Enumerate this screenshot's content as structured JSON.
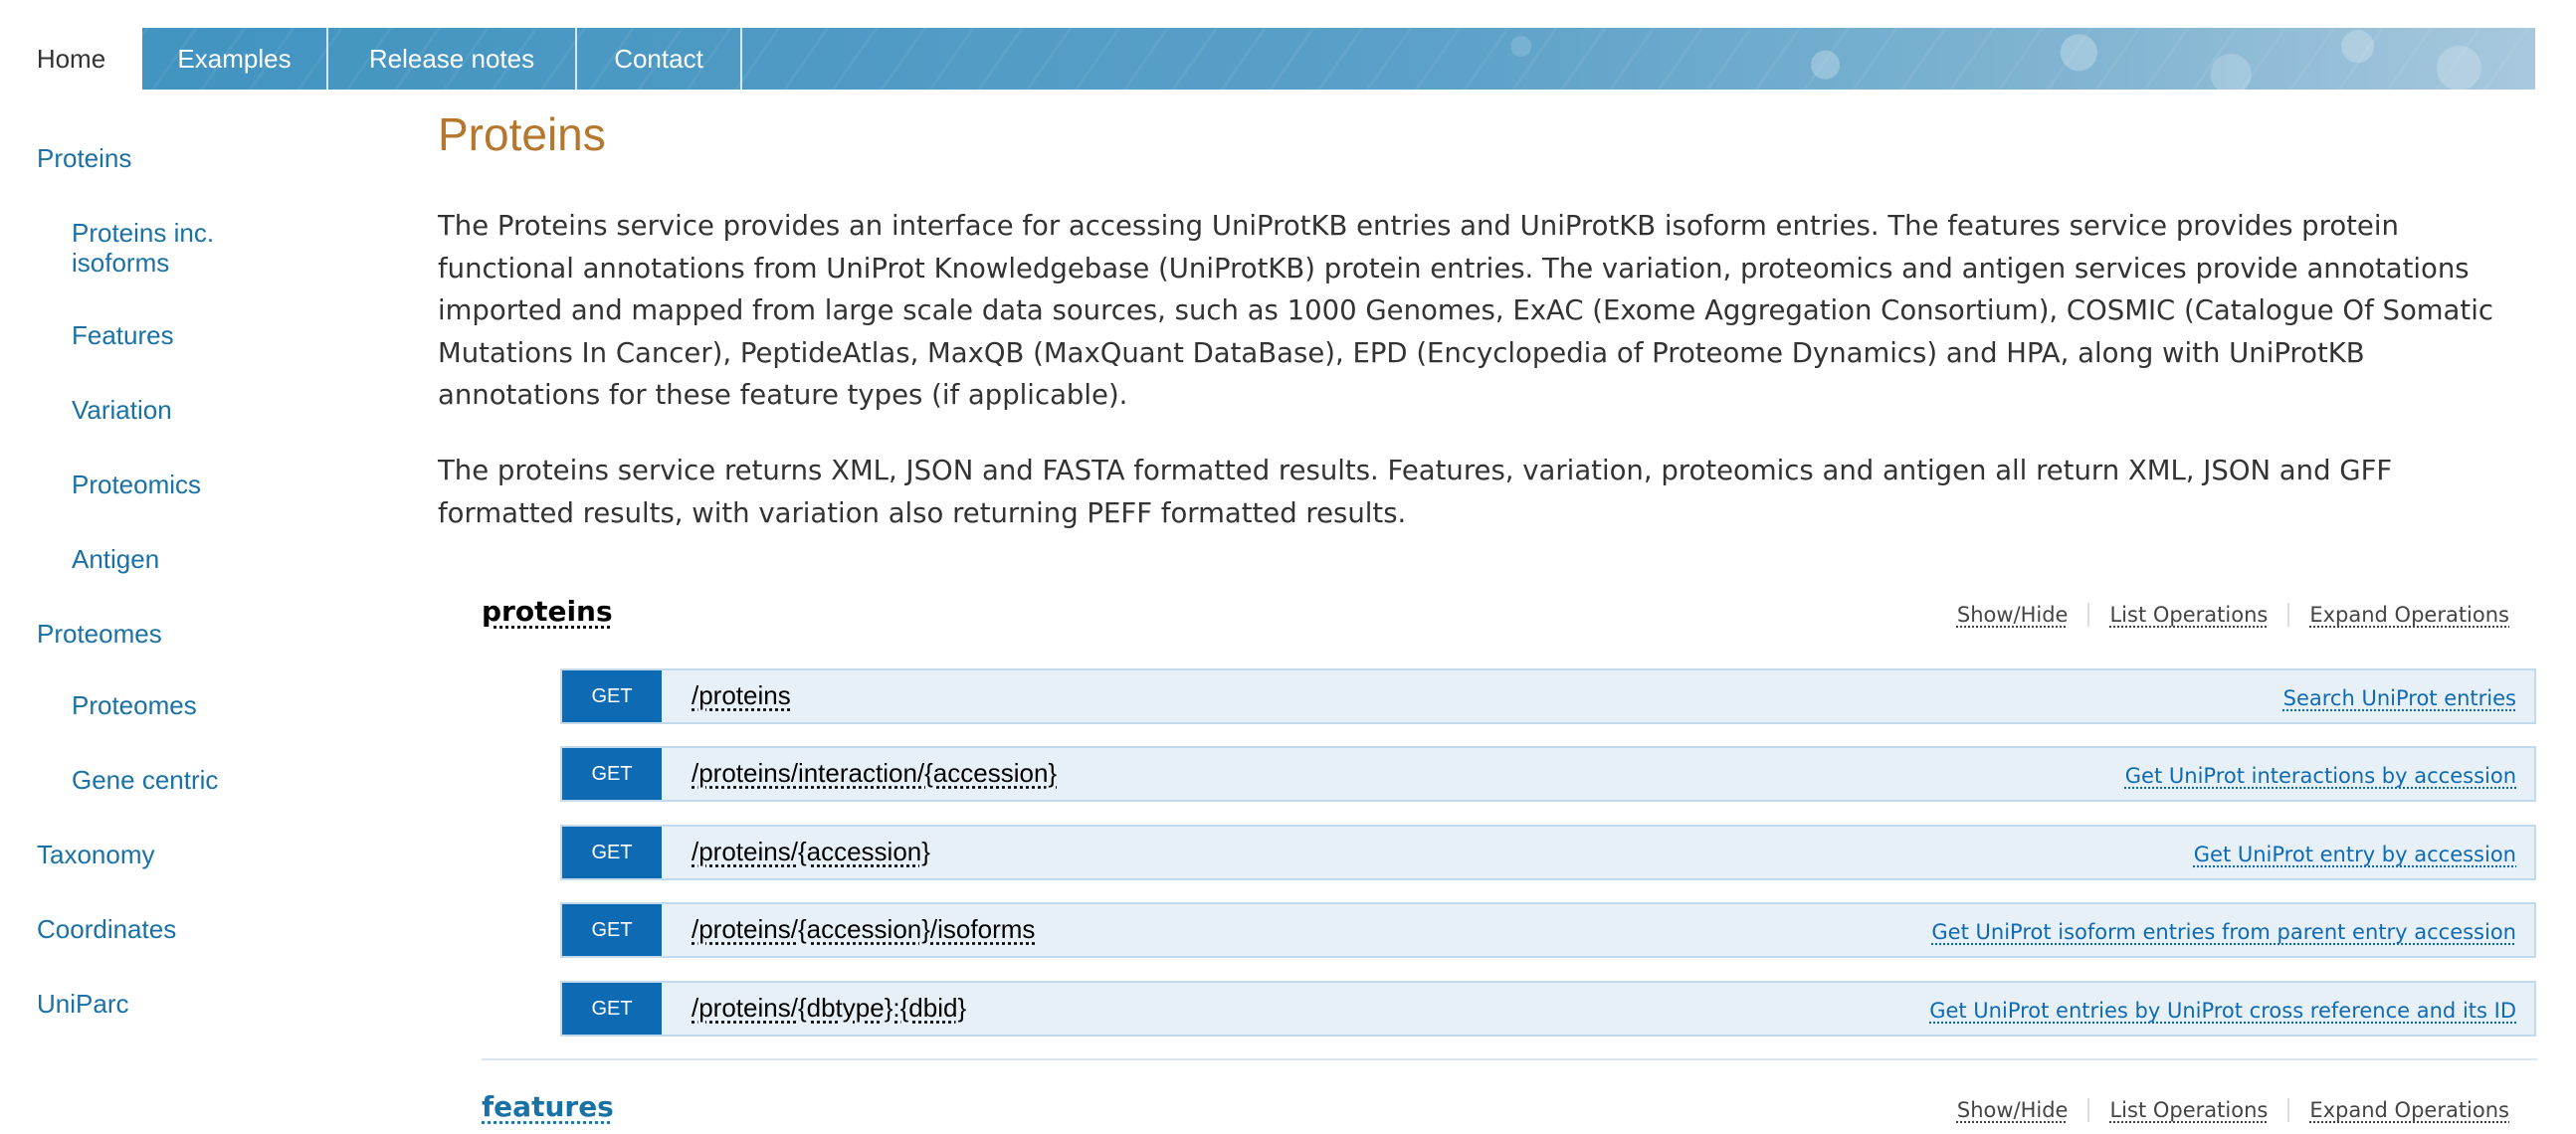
{
  "nav": {
    "tabs": [
      {
        "label": "Home"
      },
      {
        "label": "Examples"
      },
      {
        "label": "Release notes"
      },
      {
        "label": "Contact"
      }
    ]
  },
  "sidebar": {
    "items": [
      {
        "label": "Proteins"
      },
      {
        "label": "Proteins inc.\nisoforms"
      },
      {
        "label": "Features"
      },
      {
        "label": "Variation"
      },
      {
        "label": "Proteomics"
      },
      {
        "label": "Antigen"
      },
      {
        "label": "Proteomes"
      },
      {
        "label": "Proteomes"
      },
      {
        "label": "Gene centric"
      },
      {
        "label": "Taxonomy"
      },
      {
        "label": "Coordinates"
      },
      {
        "label": "UniParc"
      }
    ]
  },
  "main": {
    "title": "Proteins",
    "paragraph1": "The Proteins service provides an interface for accessing UniProtKB entries and UniProtKB isoform entries. The features service provides protein functional annotations from UniProt Knowledgebase (UniProtKB) protein entries. The variation, proteomics and antigen services provide annotations imported and mapped from large scale data sources, such as 1000 Genomes, ExAC (Exome Aggregation Consortium), COSMIC (Catalogue Of Somatic Mutations In Cancer), PeptideAtlas, MaxQB (MaxQuant DataBase), EPD (Encyclopedia of Proteome Dynamics) and HPA, along with UniProtKB annotations for these feature types (if applicable).",
    "paragraph2": "The proteins service returns XML, JSON and FASTA formatted results. Features, variation, proteomics and antigen all return XML, JSON and GFF formatted results, with variation also returning PEFF formatted results."
  },
  "swagger": {
    "ops_labels": {
      "show_hide": "Show/Hide",
      "list": "List Operations",
      "expand": "Expand Operations"
    },
    "resources": [
      {
        "name": "proteins",
        "operations": [
          {
            "method": "GET",
            "path": "/proteins",
            "summary": "Search UniProt entries"
          },
          {
            "method": "GET",
            "path": "/proteins/interaction/{accession}",
            "summary": "Get UniProt interactions by accession"
          },
          {
            "method": "GET",
            "path": "/proteins/{accession}",
            "summary": "Get UniProt entry by accession"
          },
          {
            "method": "GET",
            "path": "/proteins/{accession}/isoforms",
            "summary": "Get UniProt isoform entries from parent entry accession"
          },
          {
            "method": "GET",
            "path": "/proteins/{dbtype}:{dbid}",
            "summary": "Get UniProt entries by UniProt cross reference and its ID"
          }
        ]
      },
      {
        "name": "features",
        "operations": []
      }
    ]
  },
  "colors": {
    "nav_bg": "#3a8cba",
    "link": "#1a71a6",
    "title": "#b5762e",
    "get_badge": "#0f6ab4",
    "op_bg": "#e7f0f7"
  }
}
